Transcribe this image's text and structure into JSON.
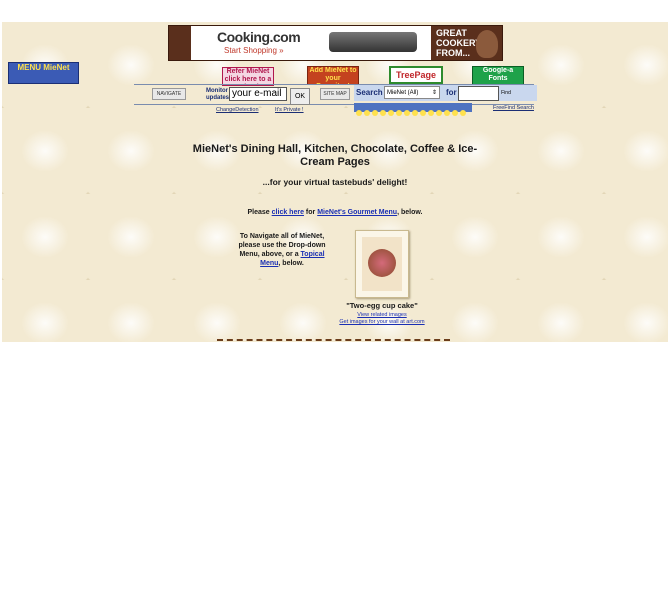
{
  "ad": {
    "logo": "Cooking.com",
    "cta": "Start Shopping »",
    "headline": "GREAT COOKERY FROM..."
  },
  "menu_logo": {
    "text": "MENU MieNet"
  },
  "banners": [
    {
      "label": "Refer MieNet click here to a Friend"
    },
    {
      "label": "Add MieNet to your Favorites!"
    },
    {
      "label": "TreePage"
    },
    {
      "label": "Google-a Fonts"
    }
  ],
  "navbar": {
    "navigate_label": "NAVIGATE",
    "monitor_label": "Monitor updates",
    "email_value": "your e-mail",
    "ok_label": "OK",
    "sitemap_label": "SITE MAP",
    "search_label": "Search",
    "search_select": "MieNet (All)",
    "for_label": "for",
    "find_label": "Find",
    "change_detection": "ChangeDetection",
    "private_label": "It's Private !",
    "freefind_label": "FreeFind Search"
  },
  "main": {
    "title": "MieNet's Dining Hall, Kitchen, Chocolate, Coffee & Ice-Cream Pages",
    "tagline": "...for your virtual tastebuds' delight!",
    "please_prefix": "Please",
    "please_link1": "click here",
    "please_mid": "for",
    "please_link2": "MieNet's Gourmet Menu",
    "please_suffix": ", below.",
    "nav_text": "To Navigate all of MieNet, please use the Drop-down Menu, above, or a",
    "nav_link": "Topical Menu",
    "nav_suffix": ", below.",
    "caption": "\"Two-egg cup cake\"",
    "view_related": "View related images",
    "get_images": "Get images for your wall at art.com"
  }
}
